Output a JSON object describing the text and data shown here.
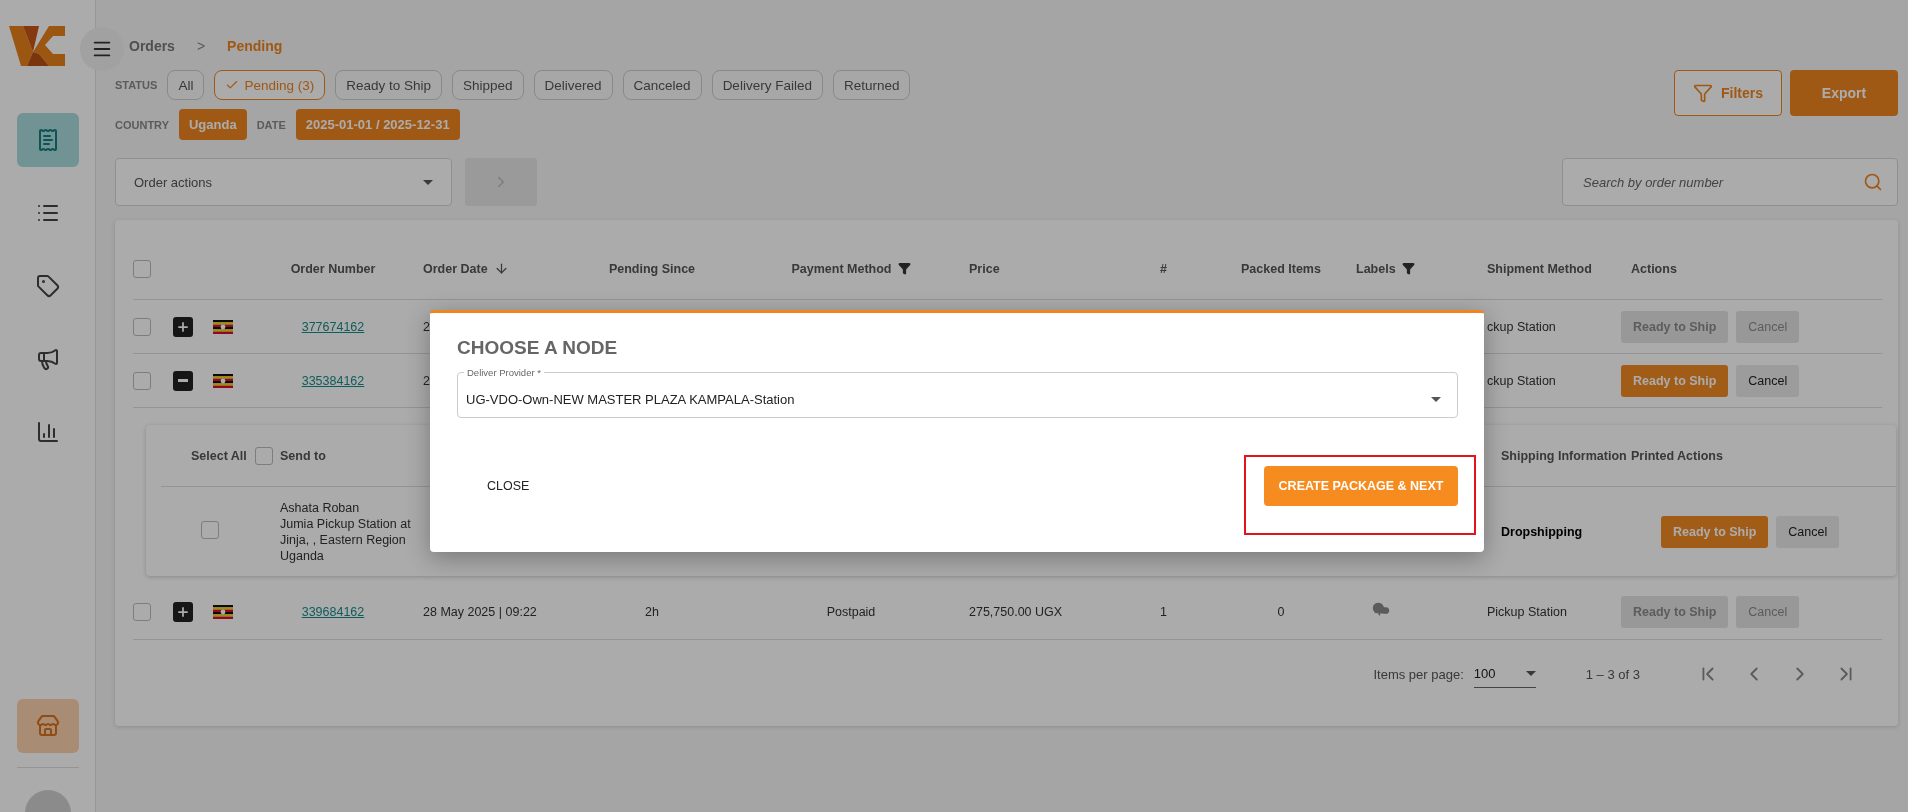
{
  "sidebar": {
    "nav": [
      {
        "kind": "receipt",
        "selected": true
      },
      {
        "kind": "list",
        "selected": false
      },
      {
        "kind": "tag",
        "selected": false
      },
      {
        "kind": "megaphone",
        "selected": false
      },
      {
        "kind": "chart",
        "selected": false
      }
    ],
    "bottom": [
      {
        "kind": "store",
        "selected": true
      }
    ]
  },
  "breadcrumb": {
    "items": [
      "Orders",
      "Pending"
    ],
    "separator": ">"
  },
  "status": {
    "label": "STATUS",
    "chips": [
      {
        "label": "All",
        "selected": false
      },
      {
        "label": "Pending (3)",
        "selected": true
      },
      {
        "label": "Ready to Ship",
        "selected": false
      },
      {
        "label": "Shipped",
        "selected": false
      },
      {
        "label": "Delivered",
        "selected": false
      },
      {
        "label": "Canceled",
        "selected": false
      },
      {
        "label": "Delivery Failed",
        "selected": false
      },
      {
        "label": "Returned",
        "selected": false
      }
    ]
  },
  "country": {
    "label": "COUNTRY",
    "value": "Uganda"
  },
  "date": {
    "label": "DATE",
    "value": "2025-01-01 / 2025-12-31"
  },
  "filters_button": "Filters",
  "export_button": "Export",
  "order_actions": {
    "placeholder": "Order actions",
    "apply_disabled": true
  },
  "search": {
    "placeholder": "Search by order number"
  },
  "table": {
    "select_all_checked": false,
    "columns": [
      {
        "label": "Order Number"
      },
      {
        "label": "Order Date",
        "sorted_descending": true
      },
      {
        "label": "Pending Since"
      },
      {
        "label": "Payment Method",
        "filter": true
      },
      {
        "label": "Price"
      },
      {
        "label": "#"
      },
      {
        "label": "Packed Items"
      },
      {
        "label": "Labels",
        "filter": true
      },
      {
        "label": "Shipment Method"
      },
      {
        "label": "Actions"
      }
    ],
    "rows": [
      {
        "checked": false,
        "expanded": false,
        "order_number": "377674162",
        "order_date": "2",
        "shipment": "ckup Station",
        "actions": [
          {
            "label": "Ready to Ship",
            "kind": "primary",
            "disabled": true
          },
          {
            "label": "Cancel",
            "kind": "secondary",
            "disabled": true
          }
        ]
      },
      {
        "checked": false,
        "expanded": true,
        "order_number": "335384162",
        "order_date": "2",
        "shipment": "ckup Station",
        "actions": [
          {
            "label": "Ready to Ship",
            "kind": "primary",
            "disabled": false
          },
          {
            "label": "Cancel",
            "kind": "secondary",
            "disabled": false
          }
        ],
        "detail": {
          "select_all": "Select All",
          "select_all_checked": false,
          "send_to": "Send to",
          "shipping_information": "Shipping Information",
          "printed_actions": "Printed Actions",
          "items": [
            {
              "checked": false,
              "address": [
                "Ashata Roban",
                "Jumia Pickup Station at",
                "Jinja, , Eastern Region",
                "Uganda"
              ],
              "shipping": "Dropshipping",
              "actions": [
                {
                  "label": "Ready to Ship",
                  "kind": "primary",
                  "disabled": false
                },
                {
                  "label": "Cancel",
                  "kind": "secondary",
                  "disabled": false
                }
              ]
            }
          ]
        }
      },
      {
        "checked": false,
        "expanded": false,
        "order_number": "339684162",
        "order_date": "28 May 2025",
        "time_separator": "|",
        "order_time": "09:22",
        "pending_since": "2h",
        "payment": "Postpaid",
        "price": "275,750.00 UGX",
        "count": "1",
        "packed": "0",
        "label_download": true,
        "shipment": "Pickup Station",
        "actions": [
          {
            "label": "Ready to Ship",
            "kind": "primary",
            "disabled": true
          },
          {
            "label": "Cancel",
            "kind": "secondary",
            "disabled": true
          }
        ]
      }
    ]
  },
  "pagination": {
    "label": "Items per page:",
    "page_size": "100",
    "range": "1 – 3 of 3"
  },
  "modal": {
    "title": "CHOOSE A NODE",
    "field": {
      "label": "Deliver Provider *",
      "value": "UG-VDO-Own-NEW MASTER PLAZA KAMPALA-Station"
    },
    "close": "CLOSE",
    "submit": "CREATE PACKAGE & NEXT",
    "submit_highlighted": true
  }
}
